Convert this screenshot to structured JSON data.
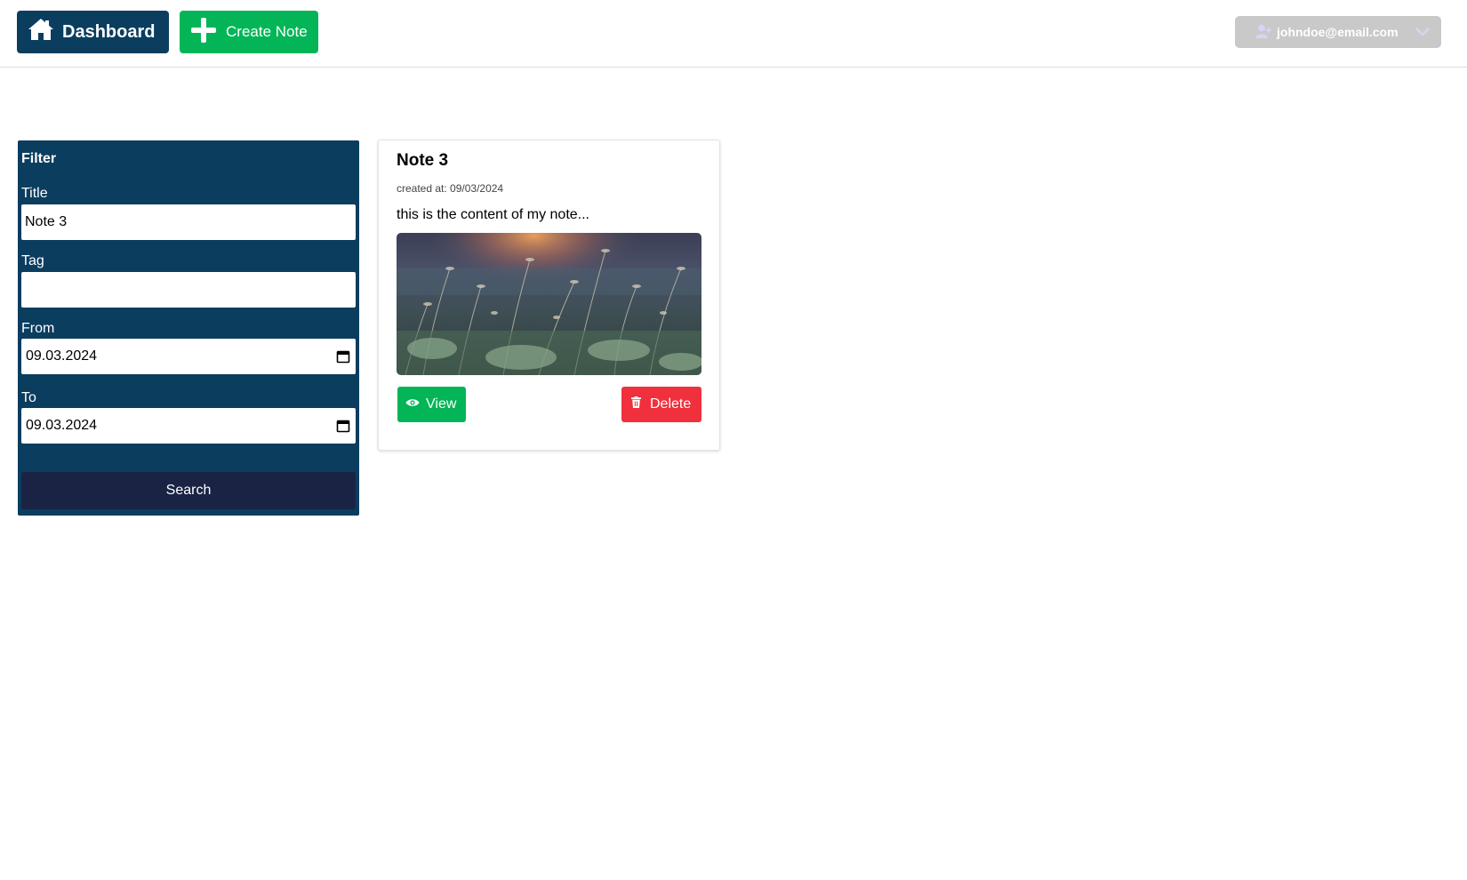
{
  "header": {
    "dashboard_label": "Dashboard",
    "create_note_label": "Create Note",
    "user_email": "johndoe@email.com"
  },
  "filter": {
    "heading": "Filter",
    "title_label": "Title",
    "title_value": "Note 3",
    "tag_label": "Tag",
    "tag_value": "",
    "from_label": "From",
    "from_value": "09.03.2024",
    "to_label": "To",
    "to_value": "09.03.2024",
    "search_label": "Search"
  },
  "notes": [
    {
      "title": "Note 3",
      "created_at": "created at: 09/03/2024",
      "content": "this is the content of my note...",
      "view_label": "View",
      "delete_label": "Delete"
    }
  ],
  "colors": {
    "primary": "#0b3d5f",
    "success": "#03b557",
    "danger": "#f0303c",
    "search_button": "#1a2344",
    "user_menu": "#c9c9c9"
  },
  "icons": {
    "dashboard": "home-icon",
    "create": "plus-icon",
    "user": "user-icon",
    "dropdown": "chevron-down-icon",
    "date": "calendar-icon",
    "view": "eye-icon",
    "delete": "trash-icon"
  }
}
